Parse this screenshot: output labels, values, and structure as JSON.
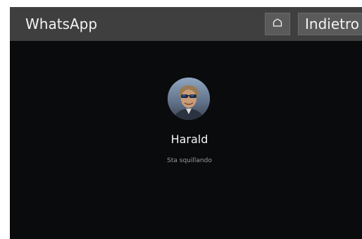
{
  "titlebar": {
    "app_title": "WhatsApp",
    "home_icon": "home-icon",
    "back_label": "Indietro"
  },
  "call": {
    "caller_name": "Harald",
    "status": "Sta squillando",
    "avatar_icon": "contact-photo"
  },
  "colors": {
    "titlebar_bg": "#3f3f3f",
    "button_bg": "#5a5a5a",
    "call_bg": "#0a0b0d",
    "name_text": "#f5f5f5",
    "status_text": "#9a9a9a"
  }
}
